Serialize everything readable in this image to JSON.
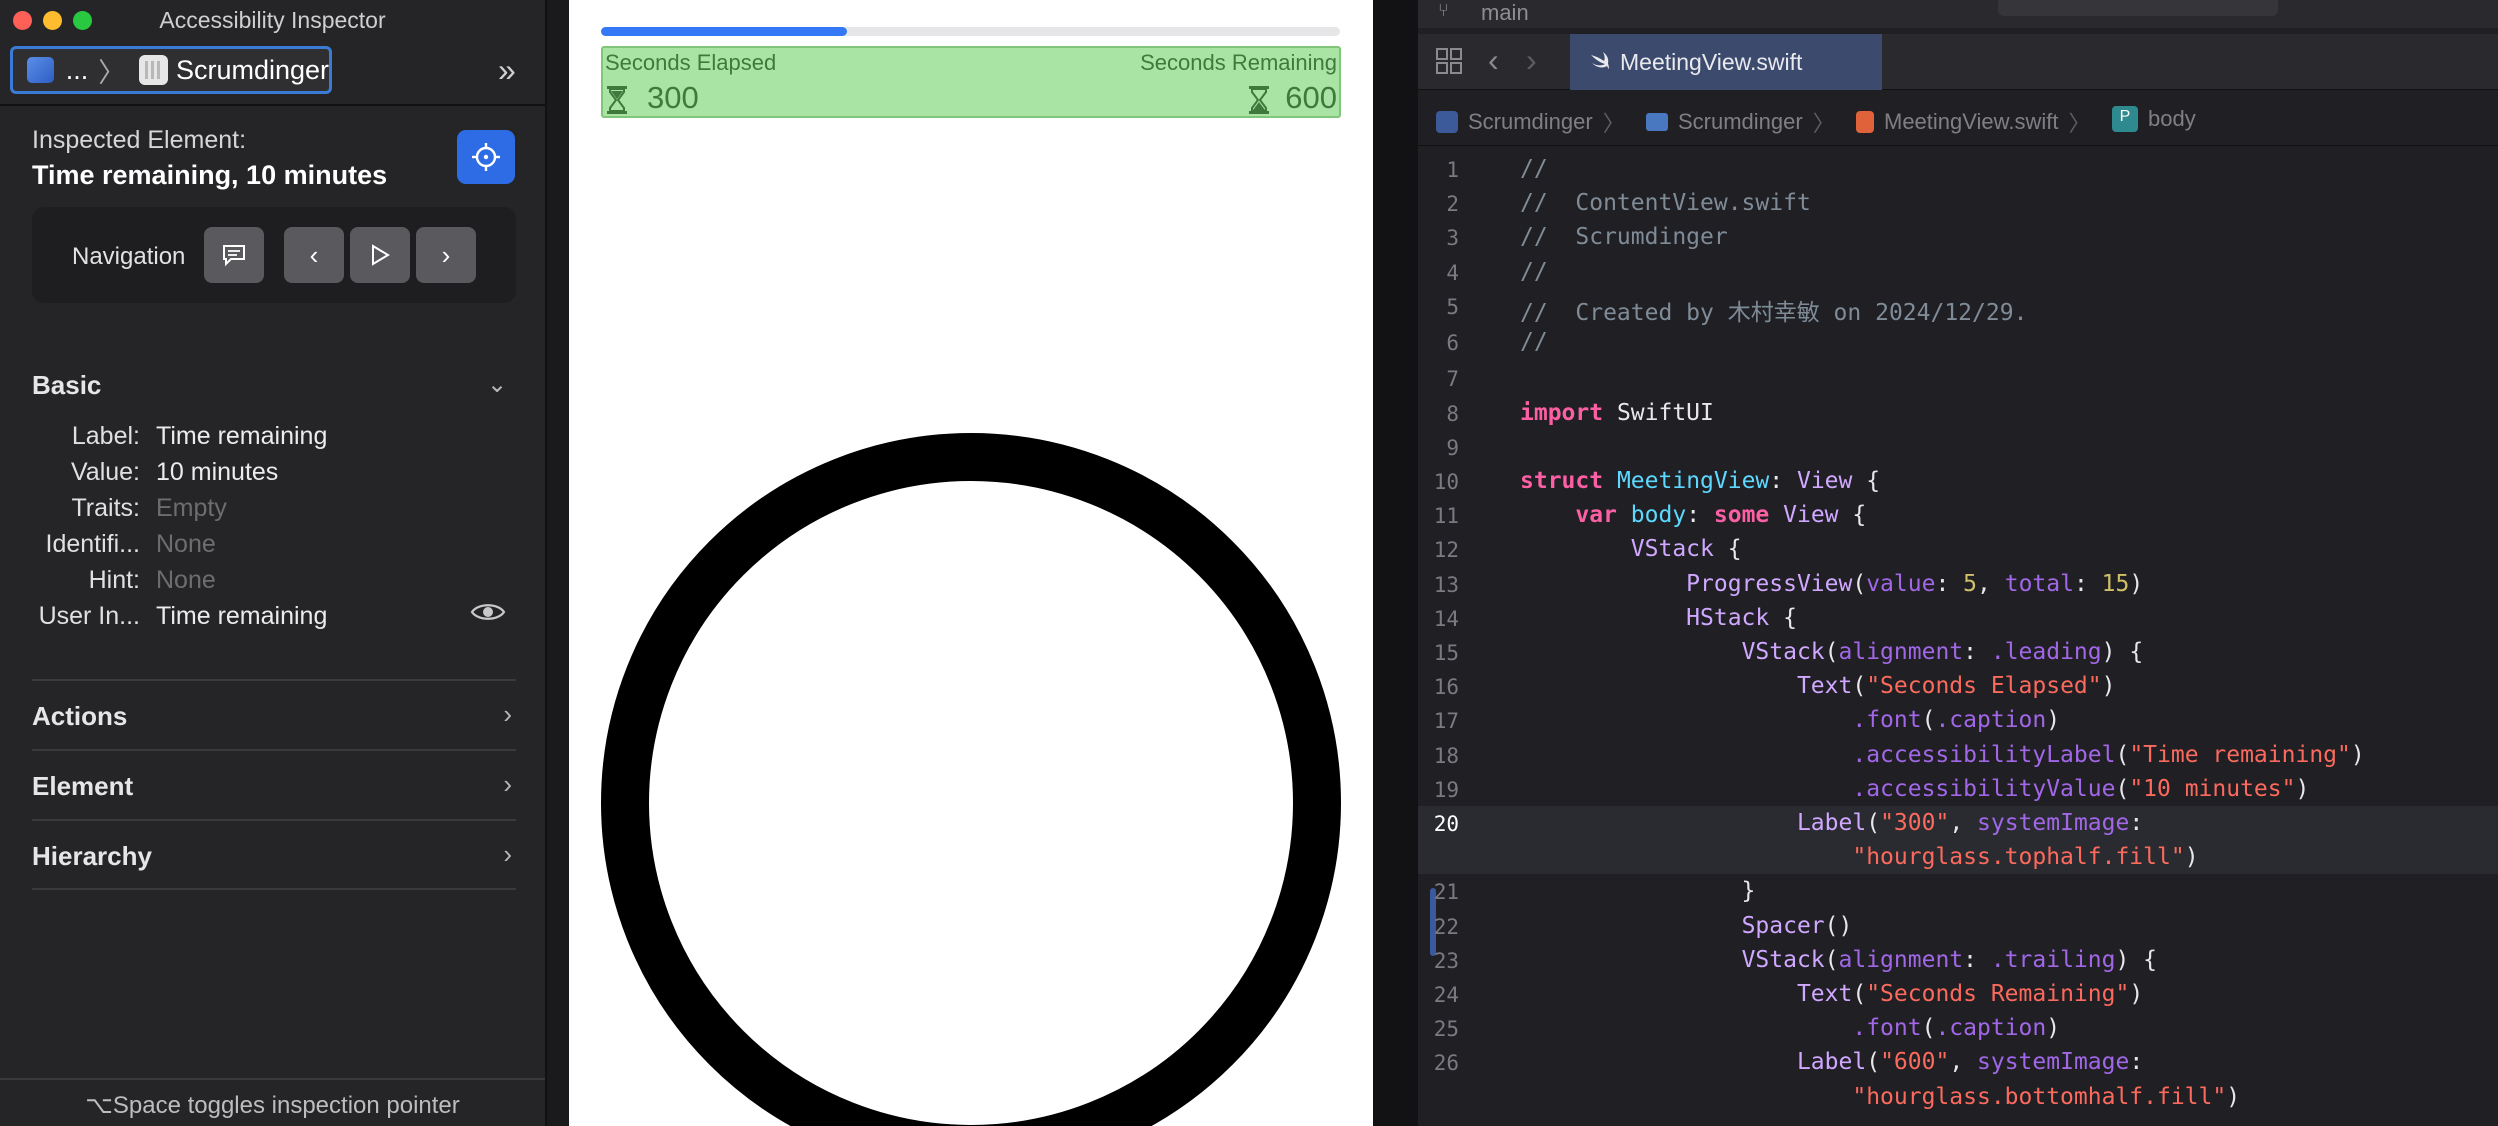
{
  "inspector": {
    "title": "Accessibility Inspector",
    "target_ellipsis": "...",
    "target_app": "Scrumdinger",
    "inspected_label": "Inspected Element:",
    "inspected_value": "Time remaining, 10 minutes",
    "navigation_label": "Navigation",
    "basic_header": "Basic",
    "properties": [
      {
        "key": "Label:",
        "value": "Time remaining"
      },
      {
        "key": "Value:",
        "value": "10 minutes"
      },
      {
        "key": "Traits:",
        "value": "Empty"
      },
      {
        "key": "Identifi...",
        "value": "None"
      },
      {
        "key": "Hint:",
        "value": "None"
      },
      {
        "key": "User In...",
        "value": "Time remaining"
      }
    ],
    "sections": [
      "Actions",
      "Element",
      "Hierarchy"
    ],
    "footer": "⌥Space toggles inspection pointer"
  },
  "simulator": {
    "progress": {
      "value": 5,
      "total": 15
    },
    "elapsed_caption": "Seconds Elapsed",
    "remaining_caption": "Seconds Remaining",
    "elapsed_value": "300",
    "remaining_value": "600"
  },
  "xcode": {
    "branch": "main",
    "active_tab": "MeetingView.swift",
    "jumpbar": [
      "Scrumdinger",
      "Scrumdinger",
      "MeetingView.swift",
      "body"
    ],
    "current_line": 20,
    "code_lines": [
      {
        "n": "1",
        "text": "//"
      },
      {
        "n": "2",
        "text": "//  ContentView.swift"
      },
      {
        "n": "3",
        "text": "//  Scrumdinger"
      },
      {
        "n": "4",
        "text": "//"
      },
      {
        "n": "5",
        "text": "//  Created by 木村幸敏 on 2024/12/29."
      },
      {
        "n": "6",
        "text": "//"
      },
      {
        "n": "7",
        "text": ""
      },
      {
        "n": "8",
        "text": "import SwiftUI"
      },
      {
        "n": "9",
        "text": ""
      },
      {
        "n": "10",
        "text": "struct MeetingView: View {"
      },
      {
        "n": "11",
        "text": "    var body: some View {"
      },
      {
        "n": "12",
        "text": "        VStack {"
      },
      {
        "n": "13",
        "text": "            ProgressView(value: 5, total: 15)"
      },
      {
        "n": "14",
        "text": "            HStack {"
      },
      {
        "n": "15",
        "text": "                VStack(alignment: .leading) {"
      },
      {
        "n": "16",
        "text": "                    Text(\"Seconds Elapsed\")"
      },
      {
        "n": "17",
        "text": "                        .font(.caption)"
      },
      {
        "n": "18",
        "text": "                        .accessibilityLabel(\"Time remaining\")"
      },
      {
        "n": "19",
        "text": "                        .accessibilityValue(\"10 minutes\")"
      },
      {
        "n": "20",
        "text": "                    Label(\"300\", systemImage:"
      },
      {
        "n": "",
        "text": "                        \"hourglass.tophalf.fill\")"
      },
      {
        "n": "21",
        "text": "                }"
      },
      {
        "n": "22",
        "text": "                Spacer()"
      },
      {
        "n": "23",
        "text": "                VStack(alignment: .trailing) {"
      },
      {
        "n": "24",
        "text": "                    Text(\"Seconds Remaining\")"
      },
      {
        "n": "25",
        "text": "                        .font(.caption)"
      },
      {
        "n": "26",
        "text": "                    Label(\"600\", systemImage:"
      },
      {
        "n": "",
        "text": "                        \"hourglass.bottomhalf.fill\")"
      }
    ]
  }
}
